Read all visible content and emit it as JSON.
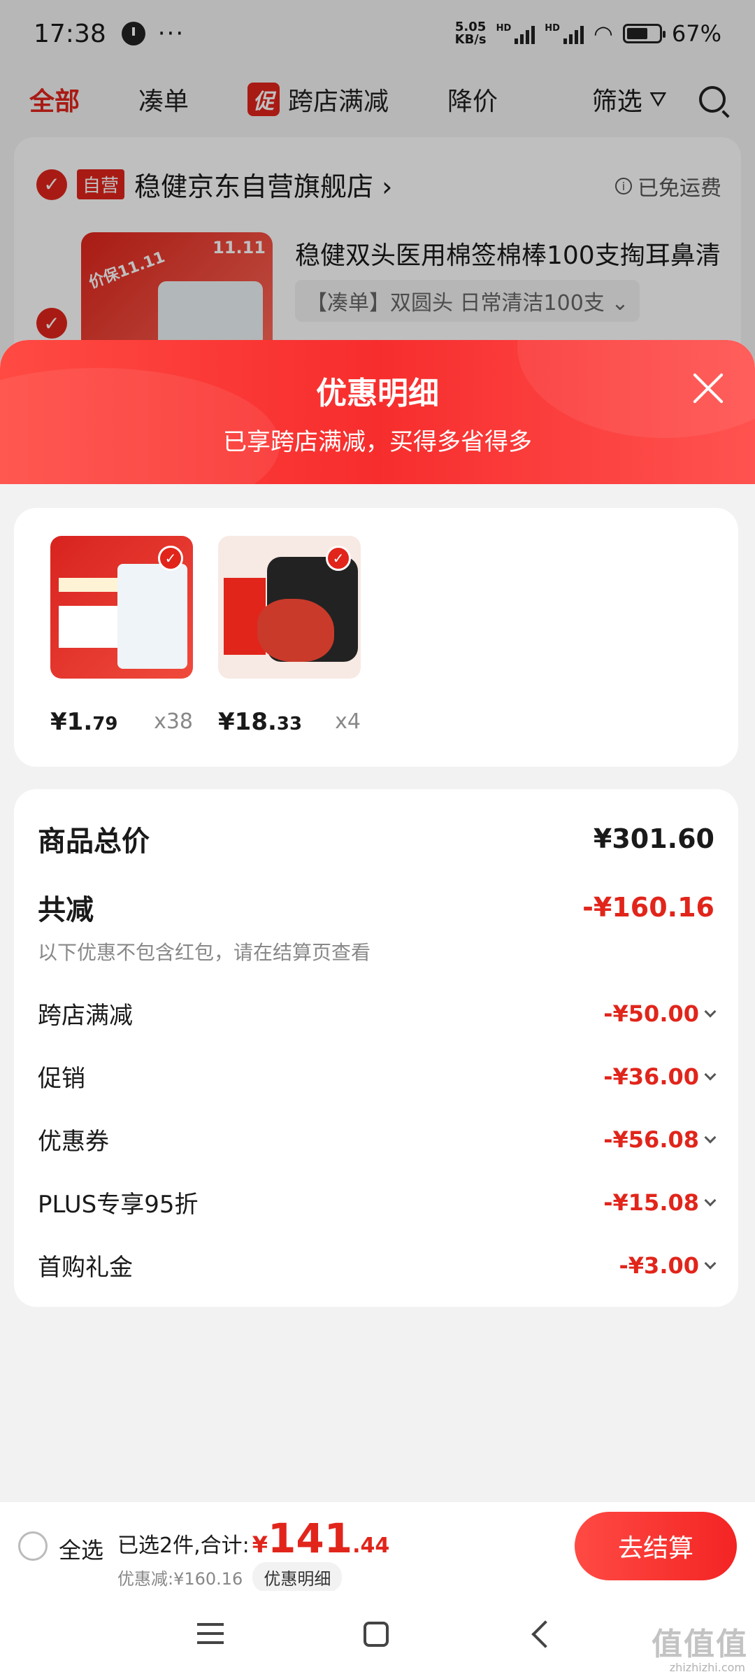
{
  "status_bar": {
    "time": "17:38",
    "dots": "···",
    "net_speed_top": "5.05",
    "net_speed_bottom": "KB/s",
    "hd1": "HD",
    "hd2": "HD",
    "battery": "67%",
    "battery_level": 0.67
  },
  "tabs": {
    "all": "全部",
    "combine": "凑单",
    "promo_badge": "促",
    "cross_store": "跨店满减",
    "price_drop": "降价",
    "filter": "筛选"
  },
  "shop": {
    "self_tag": "自营",
    "name": "稳健京东自营旗舰店 ›",
    "free_shipping": "已免运费",
    "product_title": "稳健双头医用棉签棉棒100支掏耳鼻清",
    "product_spec": "【凑单】双圆头 日常清洁100支 ⌄",
    "thumb_tag": "价保11.11",
    "thumb_count": "11.11"
  },
  "sheet": {
    "title": "优惠明细",
    "subtitle": "已享跨店满减，买得多省得多"
  },
  "items": [
    {
      "price_int": "¥1.",
      "price_dec": "79",
      "qty": "x38"
    },
    {
      "price_int": "¥18.",
      "price_dec": "33",
      "qty": "x4"
    }
  ],
  "summary": {
    "total_label": "商品总价",
    "total_value": "¥301.60",
    "reduce_label": "共减",
    "reduce_value": "-¥160.16",
    "note": "以下优惠不包含红包，请在结算页查看",
    "details": [
      {
        "label": "跨店满减",
        "value": "-¥50.00"
      },
      {
        "label": "促销",
        "value": "-¥36.00"
      },
      {
        "label": "优惠券",
        "value": "-¥56.08"
      },
      {
        "label": "PLUS专享95折",
        "value": "-¥15.08"
      },
      {
        "label": "首购礼金",
        "value": "-¥3.00"
      }
    ]
  },
  "bottom_bar": {
    "select_all": "全选",
    "selected_prefix": "已选2件,合计:",
    "currency": "¥",
    "total_int": "141",
    "total_dec": ".44",
    "discount_text": "优惠减:¥160.16",
    "discount_detail": "优惠明细",
    "checkout": "去结算"
  },
  "watermark": {
    "main": "值值值",
    "sub": "zhizhizhi.com"
  }
}
